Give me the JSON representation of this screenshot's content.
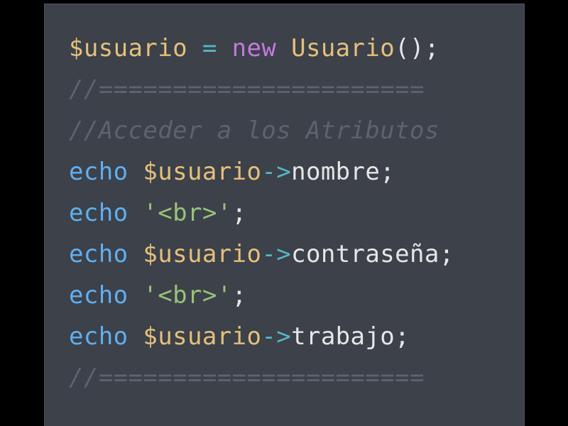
{
  "colors": {
    "background": "#000000",
    "editor_background": "#3c414a",
    "variable": "#e5c07b",
    "operator": "#56b6c2",
    "keyword_new": "#c678dd",
    "class_name": "#e5c07b",
    "punctuation": "#e6e6e6",
    "comment": "#5c6370",
    "echo": "#61afef",
    "string": "#98c379",
    "property": "#e6e6e6"
  },
  "code_lines": [
    [
      {
        "text": "$usuario",
        "color": "#e5c07b"
      },
      {
        "text": " ",
        "color": "#e6e6e6"
      },
      {
        "text": "=",
        "color": "#56b6c2"
      },
      {
        "text": " ",
        "color": "#e6e6e6"
      },
      {
        "text": "new",
        "color": "#c678dd"
      },
      {
        "text": " ",
        "color": "#e6e6e6"
      },
      {
        "text": "Usuario",
        "color": "#e5c07b"
      },
      {
        "text": "();",
        "color": "#e6e6e6"
      }
    ],
    [
      {
        "text": "//======================",
        "color": "#5c6370",
        "italic": true
      }
    ],
    [
      {
        "text": "//Acceder a los Atributos",
        "color": "#5c6370",
        "italic": true
      }
    ],
    [
      {
        "text": "echo",
        "color": "#61afef"
      },
      {
        "text": " ",
        "color": "#e6e6e6"
      },
      {
        "text": "$usuario",
        "color": "#e5c07b"
      },
      {
        "text": "->",
        "color": "#56b6c2"
      },
      {
        "text": "nombre",
        "color": "#e6e6e6"
      },
      {
        "text": ";",
        "color": "#e6e6e6"
      }
    ],
    [
      {
        "text": "echo",
        "color": "#61afef"
      },
      {
        "text": " ",
        "color": "#e6e6e6"
      },
      {
        "text": "'<br>'",
        "color": "#98c379"
      },
      {
        "text": ";",
        "color": "#e6e6e6"
      }
    ],
    [
      {
        "text": "echo",
        "color": "#61afef"
      },
      {
        "text": " ",
        "color": "#e6e6e6"
      },
      {
        "text": "$usuario",
        "color": "#e5c07b"
      },
      {
        "text": "->",
        "color": "#56b6c2"
      },
      {
        "text": "contraseña",
        "color": "#e6e6e6"
      },
      {
        "text": ";",
        "color": "#e6e6e6"
      }
    ],
    [
      {
        "text": "echo",
        "color": "#61afef"
      },
      {
        "text": " ",
        "color": "#e6e6e6"
      },
      {
        "text": "'<br>'",
        "color": "#98c379"
      },
      {
        "text": ";",
        "color": "#e6e6e6"
      }
    ],
    [
      {
        "text": "echo",
        "color": "#61afef"
      },
      {
        "text": " ",
        "color": "#e6e6e6"
      },
      {
        "text": "$usuario",
        "color": "#e5c07b"
      },
      {
        "text": "->",
        "color": "#56b6c2"
      },
      {
        "text": "trabajo",
        "color": "#e6e6e6"
      },
      {
        "text": ";",
        "color": "#e6e6e6"
      }
    ],
    [
      {
        "text": "//======================",
        "color": "#5c6370",
        "italic": true
      }
    ]
  ]
}
